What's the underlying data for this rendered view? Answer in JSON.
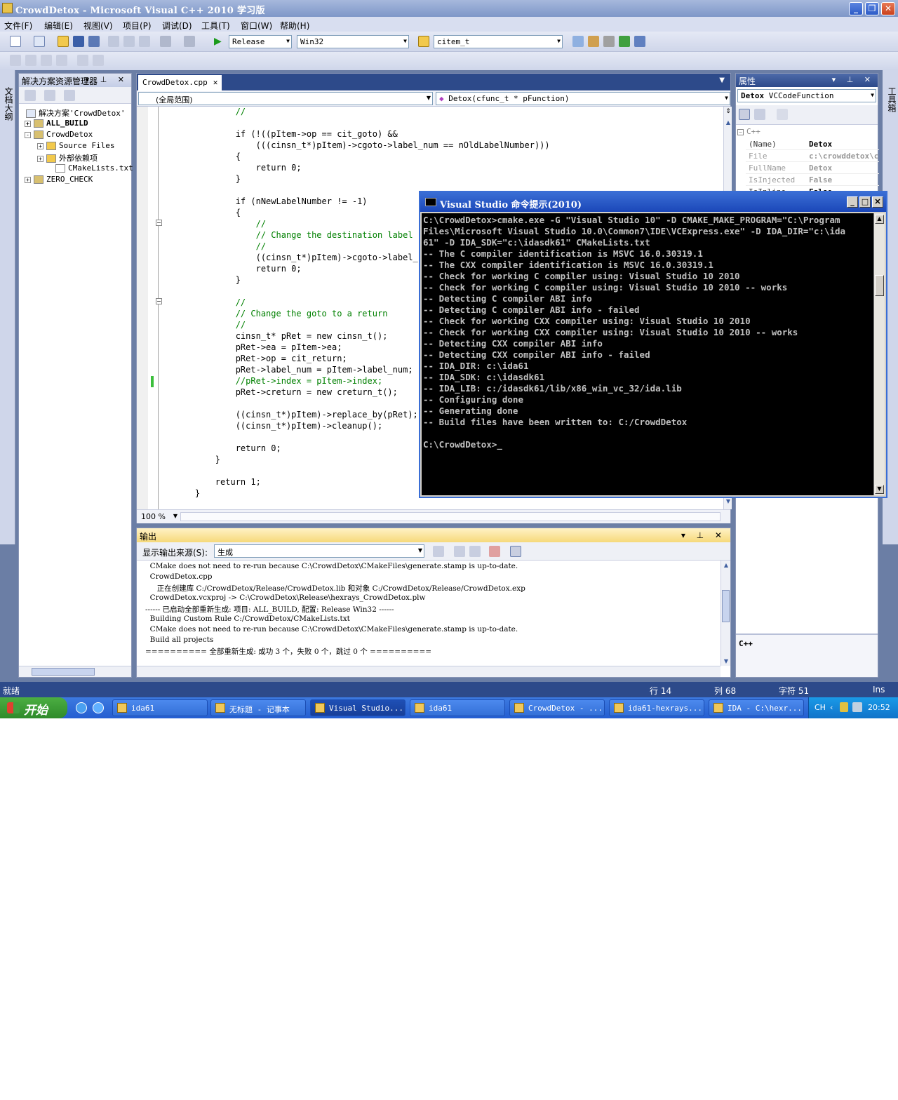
{
  "window": {
    "title": "CrowdDetox - Microsoft Visual C++ 2010 学习版",
    "controls": [
      "_",
      "❐",
      "✕"
    ]
  },
  "menu": [
    "文件(F)",
    "编辑(E)",
    "视图(V)",
    "项目(P)",
    "调试(D)",
    "工具(T)",
    "窗口(W)",
    "帮助(H)"
  ],
  "toolbar": {
    "configuration": "Release",
    "platform": "Win32",
    "find_value": "citem_t"
  },
  "side": {
    "left_tab": "文档大纲",
    "right_tab": "工具箱"
  },
  "solution_explorer": {
    "title": "解决方案资源管理器",
    "items": [
      {
        "label": "解决方案'CrowdDetox'",
        "expander": ""
      },
      {
        "label": "ALL_BUILD",
        "expander": "+"
      },
      {
        "label": "CrowdDetox",
        "expander": "-"
      },
      {
        "label": "Source Files",
        "expander": "+"
      },
      {
        "label": "外部依赖项",
        "expander": "+"
      },
      {
        "label": "CMakeLists.txt",
        "expander": ""
      },
      {
        "label": "ZERO_CHECK",
        "expander": "+"
      }
    ]
  },
  "editor": {
    "tab": "CrowdDetox.cpp",
    "scope": "(全局范围)",
    "function": "Detox(cfunc_t * pFunction)",
    "zoom": "100 %",
    "lines": [
      {
        "text": "            //",
        "cls": "cm"
      },
      {
        "text": "",
        "cls": ""
      },
      {
        "text": "            if (!((pItem->op == cit_goto) &&",
        "cls": ""
      },
      {
        "text": "                (((cinsn_t*)pItem)->cgoto->label_num == nOldLabelNumber)))",
        "cls": ""
      },
      {
        "text": "            {",
        "cls": ""
      },
      {
        "text": "                return 0;",
        "cls": ""
      },
      {
        "text": "            }",
        "cls": ""
      },
      {
        "text": "",
        "cls": ""
      },
      {
        "text": "            if (nNewLabelNumber != -1)",
        "cls": ""
      },
      {
        "text": "            {",
        "cls": ""
      },
      {
        "text": "                //",
        "cls": "cm"
      },
      {
        "text": "                // Change the destination label",
        "cls": "cm"
      },
      {
        "text": "                //",
        "cls": "cm"
      },
      {
        "text": "                ((cinsn_t*)pItem)->cgoto->label_",
        "cls": ""
      },
      {
        "text": "                return 0;",
        "cls": ""
      },
      {
        "text": "            }",
        "cls": ""
      },
      {
        "text": "",
        "cls": ""
      },
      {
        "text": "            //",
        "cls": "cm"
      },
      {
        "text": "            // Change the goto to a return",
        "cls": "cm"
      },
      {
        "text": "            //",
        "cls": "cm"
      },
      {
        "text": "            cinsn_t* pRet = new cinsn_t();",
        "cls": ""
      },
      {
        "text": "            pRet->ea = pItem->ea;",
        "cls": ""
      },
      {
        "text": "            pRet->op = cit_return;",
        "cls": ""
      },
      {
        "text": "            pRet->label_num = pItem->label_num;",
        "cls": ""
      },
      {
        "text": "            //pRet->index = pItem->index;",
        "cls": "cm"
      },
      {
        "text": "            pRet->creturn = new creturn_t();",
        "cls": ""
      },
      {
        "text": "",
        "cls": ""
      },
      {
        "text": "            ((cinsn_t*)pItem)->replace_by(pRet);",
        "cls": ""
      },
      {
        "text": "            ((cinsn_t*)pItem)->cleanup();",
        "cls": ""
      },
      {
        "text": "",
        "cls": ""
      },
      {
        "text": "            return 0;",
        "cls": ""
      },
      {
        "text": "        }",
        "cls": ""
      },
      {
        "text": "",
        "cls": ""
      },
      {
        "text": "        return 1;",
        "cls": ""
      },
      {
        "text": "    }",
        "cls": ""
      }
    ]
  },
  "properties": {
    "title": "属性",
    "object": "Detox",
    "object_type": "VCCodeFunction",
    "category": "C++",
    "rows": [
      {
        "key": "(Name)",
        "value": "Detox",
        "dim": false
      },
      {
        "key": "File",
        "value": "c:\\crowddetox\\c",
        "dim": true
      },
      {
        "key": "FullName",
        "value": "Detox",
        "dim": true
      },
      {
        "key": "IsInjected",
        "value": "False",
        "dim": true
      },
      {
        "key": "IsInline",
        "value": "False",
        "dim": false
      }
    ],
    "description": "C++"
  },
  "console": {
    "title": "Visual Studio 命令提示(2010)",
    "lines": [
      "C:\\CrowdDetox>cmake.exe -G \"Visual Studio 10\" -D CMAKE_MAKE_PROGRAM=\"C:\\Program",
      "Files\\Microsoft Visual Studio 10.0\\Common7\\IDE\\VCExpress.exe\" -D IDA_DIR=\"c:\\ida",
      "61\" -D IDA_SDK=\"c:\\idasdk61\" CMakeLists.txt",
      "-- The C compiler identification is MSVC 16.0.30319.1",
      "-- The CXX compiler identification is MSVC 16.0.30319.1",
      "-- Check for working C compiler using: Visual Studio 10 2010",
      "-- Check for working C compiler using: Visual Studio 10 2010 -- works",
      "-- Detecting C compiler ABI info",
      "-- Detecting C compiler ABI info - failed",
      "-- Check for working CXX compiler using: Visual Studio 10 2010",
      "-- Check for working CXX compiler using: Visual Studio 10 2010 -- works",
      "-- Detecting CXX compiler ABI info",
      "-- Detecting CXX compiler ABI info - failed",
      "-- IDA_DIR: c:\\ida61",
      "-- IDA_SDK: c:\\idasdk61",
      "-- IDA_LIB: c:/idasdk61/lib/x86_win_vc_32/ida.lib",
      "-- Configuring done",
      "-- Generating done",
      "-- Build files have been written to: C:/CrowdDetox",
      "",
      "C:\\CrowdDetox>_"
    ]
  },
  "output": {
    "title": "输出",
    "source_label": "显示输出来源(S):",
    "source_value": "生成",
    "lines": [
      "  CMake does not need to re-run because C:\\CrowdDetox\\CMakeFiles\\generate.stamp is up-to-date.",
      "  CrowdDetox.cpp",
      "     正在创建库 C:/CrowdDetox/Release/CrowdDetox.lib 和对象 C:/CrowdDetox/Release/CrowdDetox.exp",
      "  CrowdDetox.vcxproj -> C:\\CrowdDetox\\Release\\hexrays_CrowdDetox.plw",
      "------ 已启动全部重新生成: 项目: ALL_BUILD, 配置: Release Win32 ------",
      "  Building Custom Rule C:/CrowdDetox/CMakeLists.txt",
      "  CMake does not need to re-run because C:\\CrowdDetox\\CMakeFiles\\generate.stamp is up-to-date.",
      "  Build all projects",
      "========== 全部重新生成: 成功 3 个，失败 0 个，跳过 0 个 =========="
    ]
  },
  "statusbar": {
    "ready": "就绪",
    "line": "行 14",
    "col": "列 68",
    "ch": "字符 51",
    "mode": "Ins"
  },
  "taskbar": {
    "start": "开始",
    "tasks": [
      {
        "label": "ida61",
        "active": false
      },
      {
        "label": "无标题 - 记事本",
        "active": false
      },
      {
        "label": "Visual Studio...",
        "active": true
      },
      {
        "label": "ida61",
        "active": false
      },
      {
        "label": "CrowdDetox - ...",
        "active": false
      },
      {
        "label": "ida61-hexrays...",
        "active": false
      },
      {
        "label": "IDA - C:\\hexr...",
        "active": false
      }
    ],
    "lang": "CH",
    "clock": "20:52"
  }
}
